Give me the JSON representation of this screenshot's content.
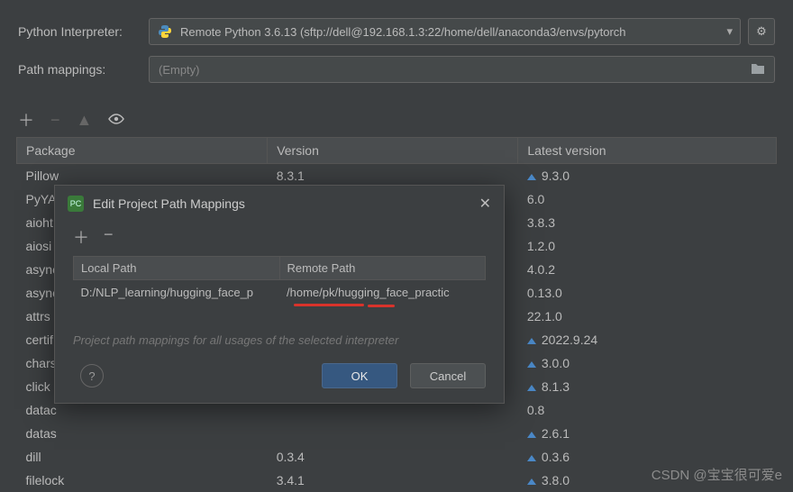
{
  "form": {
    "interpreter_label": "Python Interpreter:",
    "interpreter_value": "Remote Python 3.6.13 (sftp://dell@192.168.1.3:22/home/dell/anaconda3/envs/pytorch",
    "mappings_label": "Path mappings:",
    "mappings_value": "(Empty)"
  },
  "columns": {
    "package": "Package",
    "version": "Version",
    "latest": "Latest version"
  },
  "packages": [
    {
      "name": "Pillow",
      "version": "8.3.1",
      "latest": "9.3.0",
      "upgradable": true
    },
    {
      "name": "PyYA",
      "version": "",
      "latest": "6.0",
      "upgradable": false
    },
    {
      "name": "aioht",
      "version": "",
      "latest": "3.8.3",
      "upgradable": false
    },
    {
      "name": "aiosi",
      "version": "",
      "latest": "1.2.0",
      "upgradable": false
    },
    {
      "name": "async",
      "version": "",
      "latest": "4.0.2",
      "upgradable": false
    },
    {
      "name": "async",
      "version": "",
      "latest": "0.13.0",
      "upgradable": false
    },
    {
      "name": "attrs",
      "version": "",
      "latest": "22.1.0",
      "upgradable": false
    },
    {
      "name": "certif",
      "version": "",
      "latest": "2022.9.24",
      "upgradable": true
    },
    {
      "name": "chars",
      "version": "",
      "latest": "3.0.0",
      "upgradable": true
    },
    {
      "name": "click",
      "version": "",
      "latest": "8.1.3",
      "upgradable": true
    },
    {
      "name": "datac",
      "version": "",
      "latest": "0.8",
      "upgradable": false
    },
    {
      "name": "datas",
      "version": "",
      "latest": "2.6.1",
      "upgradable": true
    },
    {
      "name": "dill",
      "version": "0.3.4",
      "latest": "0.3.6",
      "upgradable": true
    },
    {
      "name": "filelock",
      "version": "3.4.1",
      "latest": "3.8.0",
      "upgradable": true
    }
  ],
  "dialog": {
    "title": "Edit Project Path Mappings",
    "col_local": "Local Path",
    "col_remote": "Remote Path",
    "local_val": "D:/NLP_learning/hugging_face_p",
    "remote_val": "/home/pk/hugging_face_practic",
    "hint": "Project path mappings for all usages of the selected interpreter",
    "ok": "OK",
    "cancel": "Cancel"
  },
  "watermark": "CSDN @宝宝很可爱e"
}
